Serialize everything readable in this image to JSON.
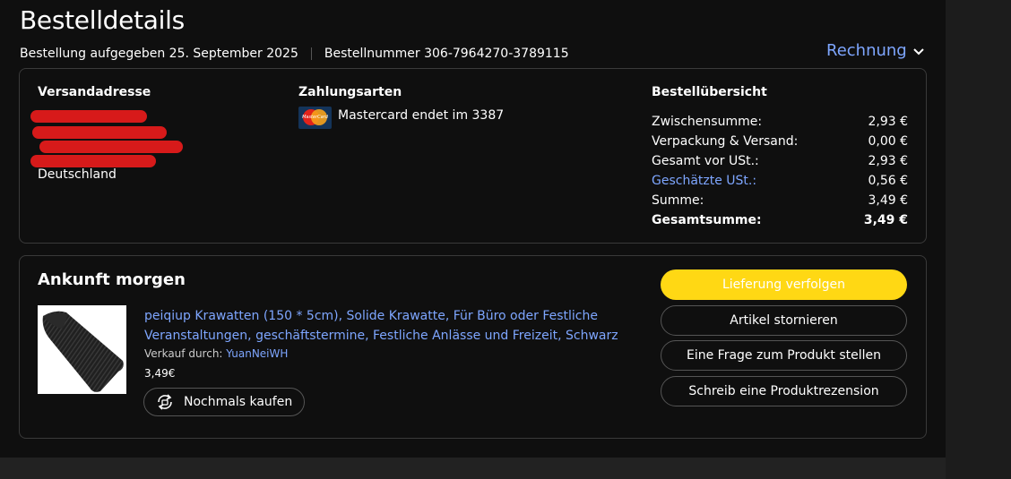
{
  "header": {
    "title": "Bestelldetails",
    "order_placed": "Bestellung aufgegeben 25. September 2025",
    "order_number": "Bestellnummer 306-7964270-3789115",
    "invoice_label": "Rechnung"
  },
  "shipping": {
    "heading": "Versandadresse",
    "country": "Deutschland"
  },
  "payment": {
    "heading": "Zahlungsarten",
    "card_text": "Mastercard endet im 3387",
    "card_logo_text": "MasterCard"
  },
  "summary": {
    "heading": "Bestellübersicht",
    "rows": [
      {
        "label": "Zwischensumme:",
        "value": "2,93 €"
      },
      {
        "label": "Verpackung & Versand:",
        "value": "0,00 €"
      },
      {
        "label": "Gesamt vor USt.:",
        "value": "2,93 €"
      },
      {
        "label": "Geschätzte USt.:",
        "value": "0,56 €"
      },
      {
        "label": "Summe:",
        "value": "3,49 €"
      },
      {
        "label": "Gesamtsumme:",
        "value": "3,49 €"
      }
    ]
  },
  "shipment": {
    "arrival": "Ankunft morgen",
    "product_title": "peiqiup Krawatten (150 * 5cm), Solide Krawatte, Für Büro oder Festliche Veranstaltungen, geschäftstermine, Festliche Anlässe und Freizeit, Schwarz",
    "sold_by_label": "Verkauf durch:",
    "seller": "YuanNeiWH",
    "price": "3,49€",
    "rebuy_label": "Nochmals kaufen"
  },
  "actions": {
    "track": "Lieferung verfolgen",
    "cancel": "Artikel stornieren",
    "question": "Eine Frage zum Produkt stellen",
    "review": "Schreib eine Produktrezension"
  },
  "colors": {
    "accent_link": "#7ea6ff",
    "primary_button": "#ffd814",
    "background": "#0f0f0f",
    "redaction": "#d71a1a"
  }
}
